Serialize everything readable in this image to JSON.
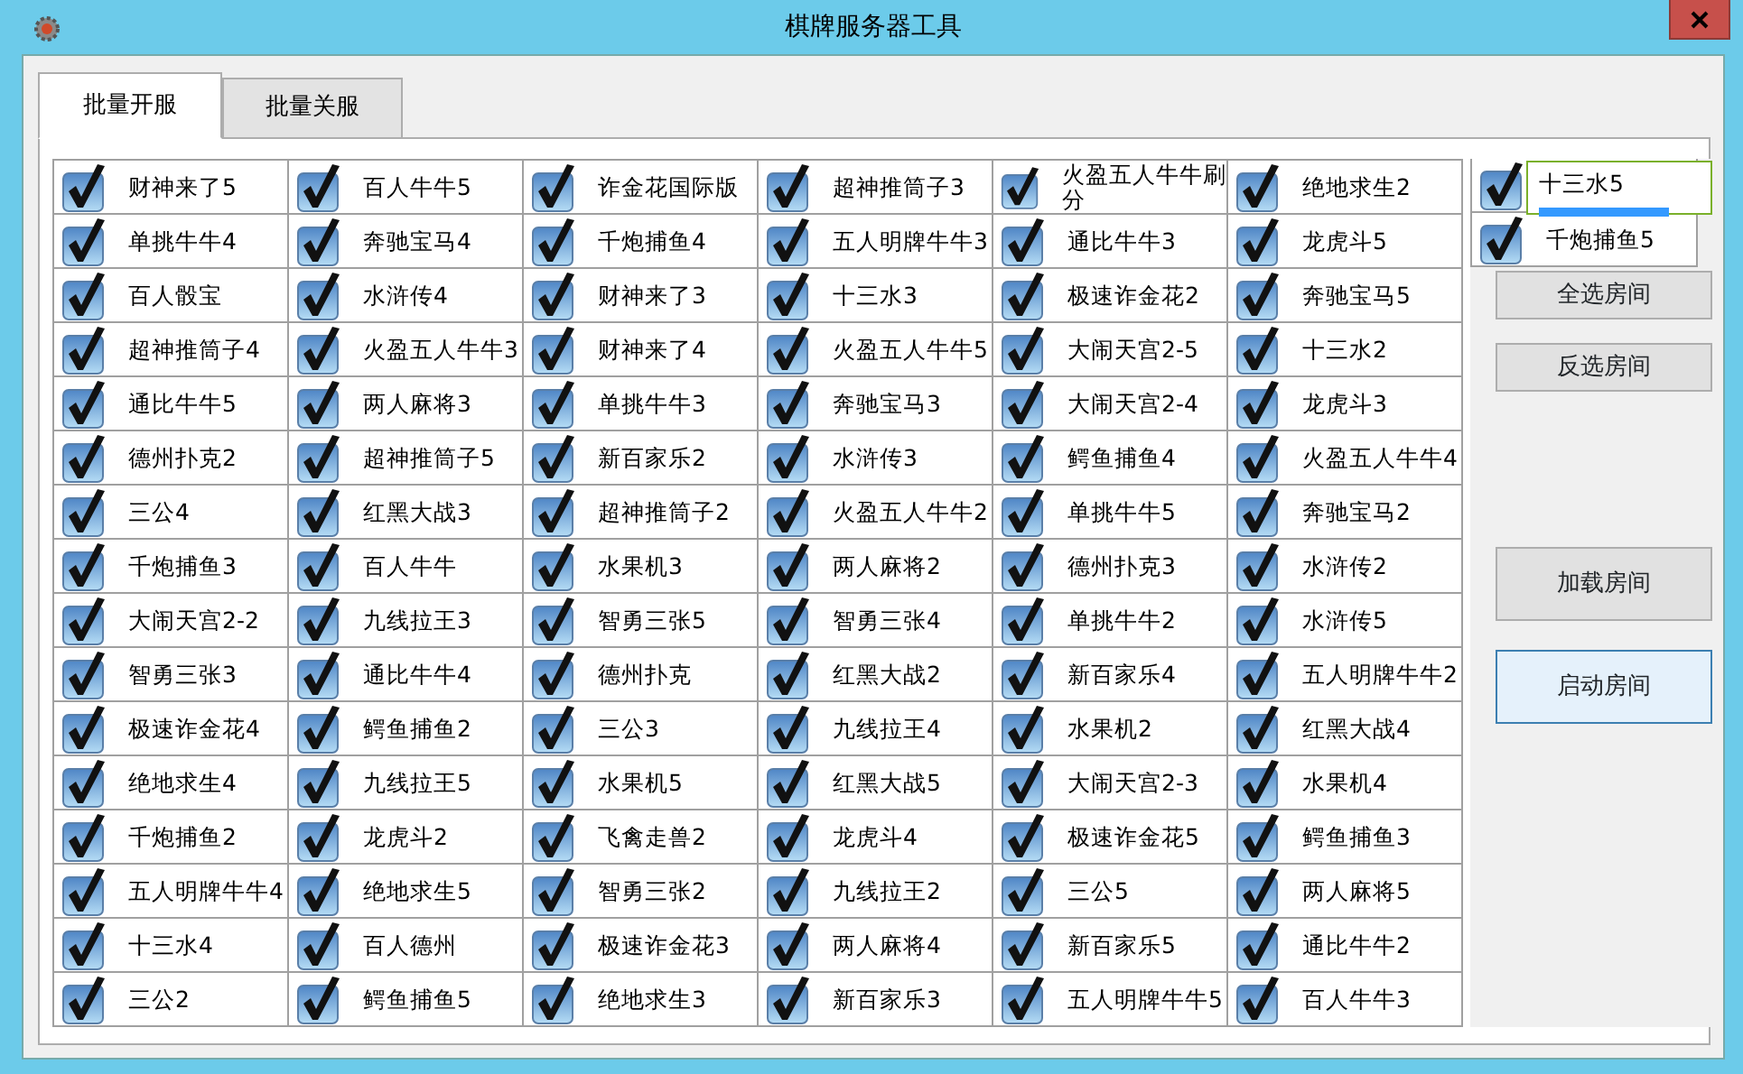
{
  "window": {
    "title": "棋牌服务器工具"
  },
  "tabs": [
    {
      "label": "批量开服",
      "selected": true
    },
    {
      "label": "批量关服",
      "selected": false
    }
  ],
  "rooms": [
    [
      "财神来了5",
      "百人牛牛5",
      "诈金花国际版",
      "超神推筒子3",
      "火盈五人牛牛刷分",
      "绝地求生2"
    ],
    [
      "单挑牛牛4",
      "奔驰宝马4",
      "千炮捕鱼4",
      "五人明牌牛牛3",
      "通比牛牛3",
      "龙虎斗5"
    ],
    [
      "百人骰宝",
      "水浒传4",
      "财神来了3",
      "十三水3",
      "极速诈金花2",
      "奔驰宝马5"
    ],
    [
      "超神推筒子4",
      "火盈五人牛牛3",
      "财神来了4",
      "火盈五人牛牛5",
      "大闹天宫2-5",
      "十三水2"
    ],
    [
      "通比牛牛5",
      "两人麻将3",
      "单挑牛牛3",
      "奔驰宝马3",
      "大闹天宫2-4",
      "龙虎斗3"
    ],
    [
      "德州扑克2",
      "超神推筒子5",
      "新百家乐2",
      "水浒传3",
      "鳄鱼捕鱼4",
      "火盈五人牛牛4"
    ],
    [
      "三公4",
      "红黑大战3",
      "超神推筒子2",
      "火盈五人牛牛2",
      "单挑牛牛5",
      "奔驰宝马2"
    ],
    [
      "千炮捕鱼3",
      "百人牛牛",
      "水果机3",
      "两人麻将2",
      "德州扑克3",
      "水浒传2"
    ],
    [
      "大闹天宫2-2",
      "九线拉王3",
      "智勇三张5",
      "智勇三张4",
      "单挑牛牛2",
      "水浒传5"
    ],
    [
      "智勇三张3",
      "通比牛牛4",
      "德州扑克",
      "红黑大战2",
      "新百家乐4",
      "五人明牌牛牛2"
    ],
    [
      "极速诈金花4",
      "鳄鱼捕鱼2",
      "三公3",
      "九线拉王4",
      "水果机2",
      "红黑大战4"
    ],
    [
      "绝地求生4",
      "九线拉王5",
      "水果机5",
      "红黑大战5",
      "大闹天宫2-3",
      "水果机4"
    ],
    [
      "千炮捕鱼2",
      "龙虎斗2",
      "飞禽走兽2",
      "龙虎斗4",
      "极速诈金花5",
      "鳄鱼捕鱼3"
    ],
    [
      "五人明牌牛牛4",
      "绝地求生5",
      "智勇三张2",
      "九线拉王2",
      "三公5",
      "两人麻将5"
    ],
    [
      "十三水4",
      "百人德州",
      "极速诈金花3",
      "两人麻将4",
      "新百家乐5",
      "通比牛牛2"
    ],
    [
      "三公2",
      "鳄鱼捕鱼5",
      "绝地求生3",
      "新百家乐3",
      "五人明牌牛牛5",
      "百人牛牛3"
    ]
  ],
  "side_rooms": [
    {
      "label": "十三水5",
      "checked": true,
      "kind": "popup"
    },
    {
      "label": "千炮捕鱼5",
      "checked": true,
      "kind": "checkbox"
    }
  ],
  "buttons": [
    {
      "label": "全选房间",
      "focused": false
    },
    {
      "label": "反选房间",
      "focused": false
    },
    {
      "label": "加载房间",
      "focused": false
    },
    {
      "label": "启动房间",
      "focused": true
    }
  ]
}
